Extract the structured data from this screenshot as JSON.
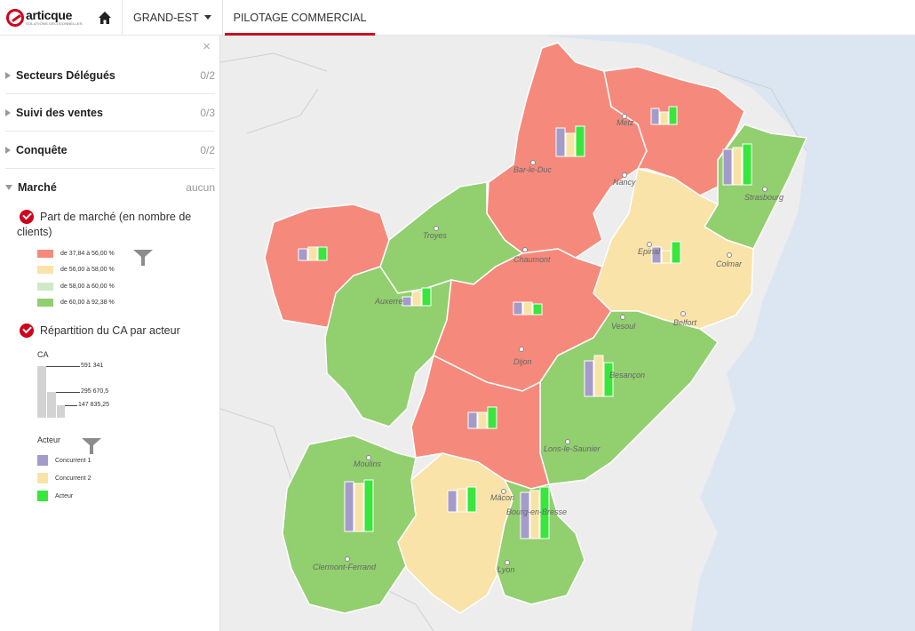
{
  "header": {
    "logo_name": "articque",
    "logo_sub": "SOLUTIONS DÉCISIONNELLES",
    "region": "GRAND-EST",
    "tab": "PILOTAGE COMMERCIAL"
  },
  "sidebar": {
    "close": "×",
    "sections": [
      {
        "label": "Secteurs Délégués",
        "count": "0/2"
      },
      {
        "label": "Suivi des ventes",
        "count": "0/3"
      },
      {
        "label": "Conquête",
        "count": "0/2"
      },
      {
        "label": "Marché",
        "count": "aucun"
      }
    ],
    "layer1": {
      "title": "Part de marché (en nombre de clients)",
      "legend": [
        {
          "label": "de 37,84 à 56,00 %",
          "color": "#f58a7c"
        },
        {
          "label": "de 56,00 à 58,00 %",
          "color": "#f9e3a8"
        },
        {
          "label": "de 58,00 à 60,00 %",
          "color": "#cfe8c6"
        },
        {
          "label": "de 60,00 à 92,38 %",
          "color": "#92cf6f"
        }
      ]
    },
    "layer2": {
      "title": "Répartition du CA par acteur",
      "ca_label": "CA",
      "ca_values": [
        "591 341",
        "295 670,5",
        "147 835,25"
      ],
      "actor_label": "Acteur",
      "actors": [
        {
          "label": "Concurrent 1",
          "color": "#a59bc9"
        },
        {
          "label": "Concurrent 2",
          "color": "#f8e3a6"
        },
        {
          "label": "Acteur",
          "color": "#39e63c"
        }
      ]
    }
  },
  "map": {
    "sea_color": "#dbe6f2",
    "land_color": "#ededed",
    "cities": [
      "Metz",
      "Bar-le-Duc",
      "Nancy",
      "Strasbourg",
      "Troyes",
      "Chaumont",
      "Epinal",
      "Colmar",
      "Auxerre",
      "Vesoul",
      "Belfort",
      "Dijon",
      "Besançon",
      "Lons-le-Saunier",
      "Moulins",
      "Mâcon",
      "Bourg-en-Bresse",
      "Clermont-Ferrand",
      "Lyon"
    ]
  }
}
